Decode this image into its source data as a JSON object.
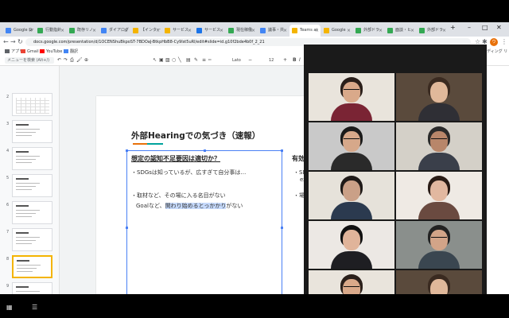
{
  "browser": {
    "tabs": [
      {
        "label": "Google Dr",
        "color": "#4285f4",
        "active": false
      },
      {
        "label": "行動指針",
        "color": "#34a853",
        "active": false
      },
      {
        "label": "既存リノ",
        "color": "#34a853",
        "active": false
      },
      {
        "label": "ダイアログ",
        "color": "#4285f4",
        "active": false
      },
      {
        "label": "【インター",
        "color": "#f4b400",
        "active": false
      },
      {
        "label": "サービス",
        "color": "#f4b400",
        "active": false
      },
      {
        "label": "サービス",
        "color": "#1a73e8",
        "active": false
      },
      {
        "label": "現在稼働",
        "color": "#34a853",
        "active": false
      },
      {
        "label": "議事・共",
        "color": "#4285f4",
        "active": false
      },
      {
        "label": "Teams ai",
        "color": "#f4b400",
        "active": true
      },
      {
        "label": "Google",
        "color": "#f4b400",
        "active": false
      },
      {
        "label": "外部ドラ",
        "color": "#34a853",
        "active": false
      },
      {
        "label": "面談・ヒ",
        "color": "#34a853",
        "active": false
      },
      {
        "label": "外部ドラ",
        "color": "#34a853",
        "active": false
      }
    ],
    "new_tab": "+",
    "window_controls": [
      "–",
      "□",
      "✕"
    ],
    "url": "docs.google.com/presentation/d/1OCENShuBkpoST-7BDOaJ-BtkpHbB8-Cy9Ist5uRl/edit#slide=id.g10f2bde4b0f_2_21",
    "profile_initial": "ウ",
    "bookmarks": [
      {
        "label": "アプリ",
        "color": "#5f6368"
      },
      {
        "label": "Gmail",
        "color": "#ea4335"
      },
      {
        "label": "YouTube",
        "color": "#ff0000"
      },
      {
        "label": "翻訳",
        "color": "#4285f4"
      }
    ],
    "reading_list": "リーディング リスト"
  },
  "slides_toolbar": {
    "menu_search_placeholder": "メニューを検索 (Alt+/)",
    "font_name": "Lato",
    "font_size": "12"
  },
  "filmstrip": {
    "slide_numbers": [
      "2",
      "3",
      "4",
      "5",
      "6",
      "7",
      "8",
      "9"
    ],
    "selected_index": 6
  },
  "slide": {
    "title": "外部Hearingでの気づき（速報）",
    "accent_colors": [
      "#e8710a",
      "#00a39c"
    ],
    "question_heading": "想定の認知不足要因は適切か？",
    "bullet1": "・SDGsは知っているが、広すぎて自分事は…",
    "bullet2": "・取材など、その場に入る名目がない",
    "bullet3_pre": "Goalなど、",
    "bullet3_hl": "関わり始めるとっかかり",
    "bullet3_post": "がない",
    "right_heading_fragment": "有効",
    "right_frag1": "・SD",
    "right_frag2": "ex",
    "right_frag3": "・場"
  },
  "zoom": {
    "participant_count": 10,
    "active_speaker_index": 0,
    "active_color": "#a6e35a"
  }
}
